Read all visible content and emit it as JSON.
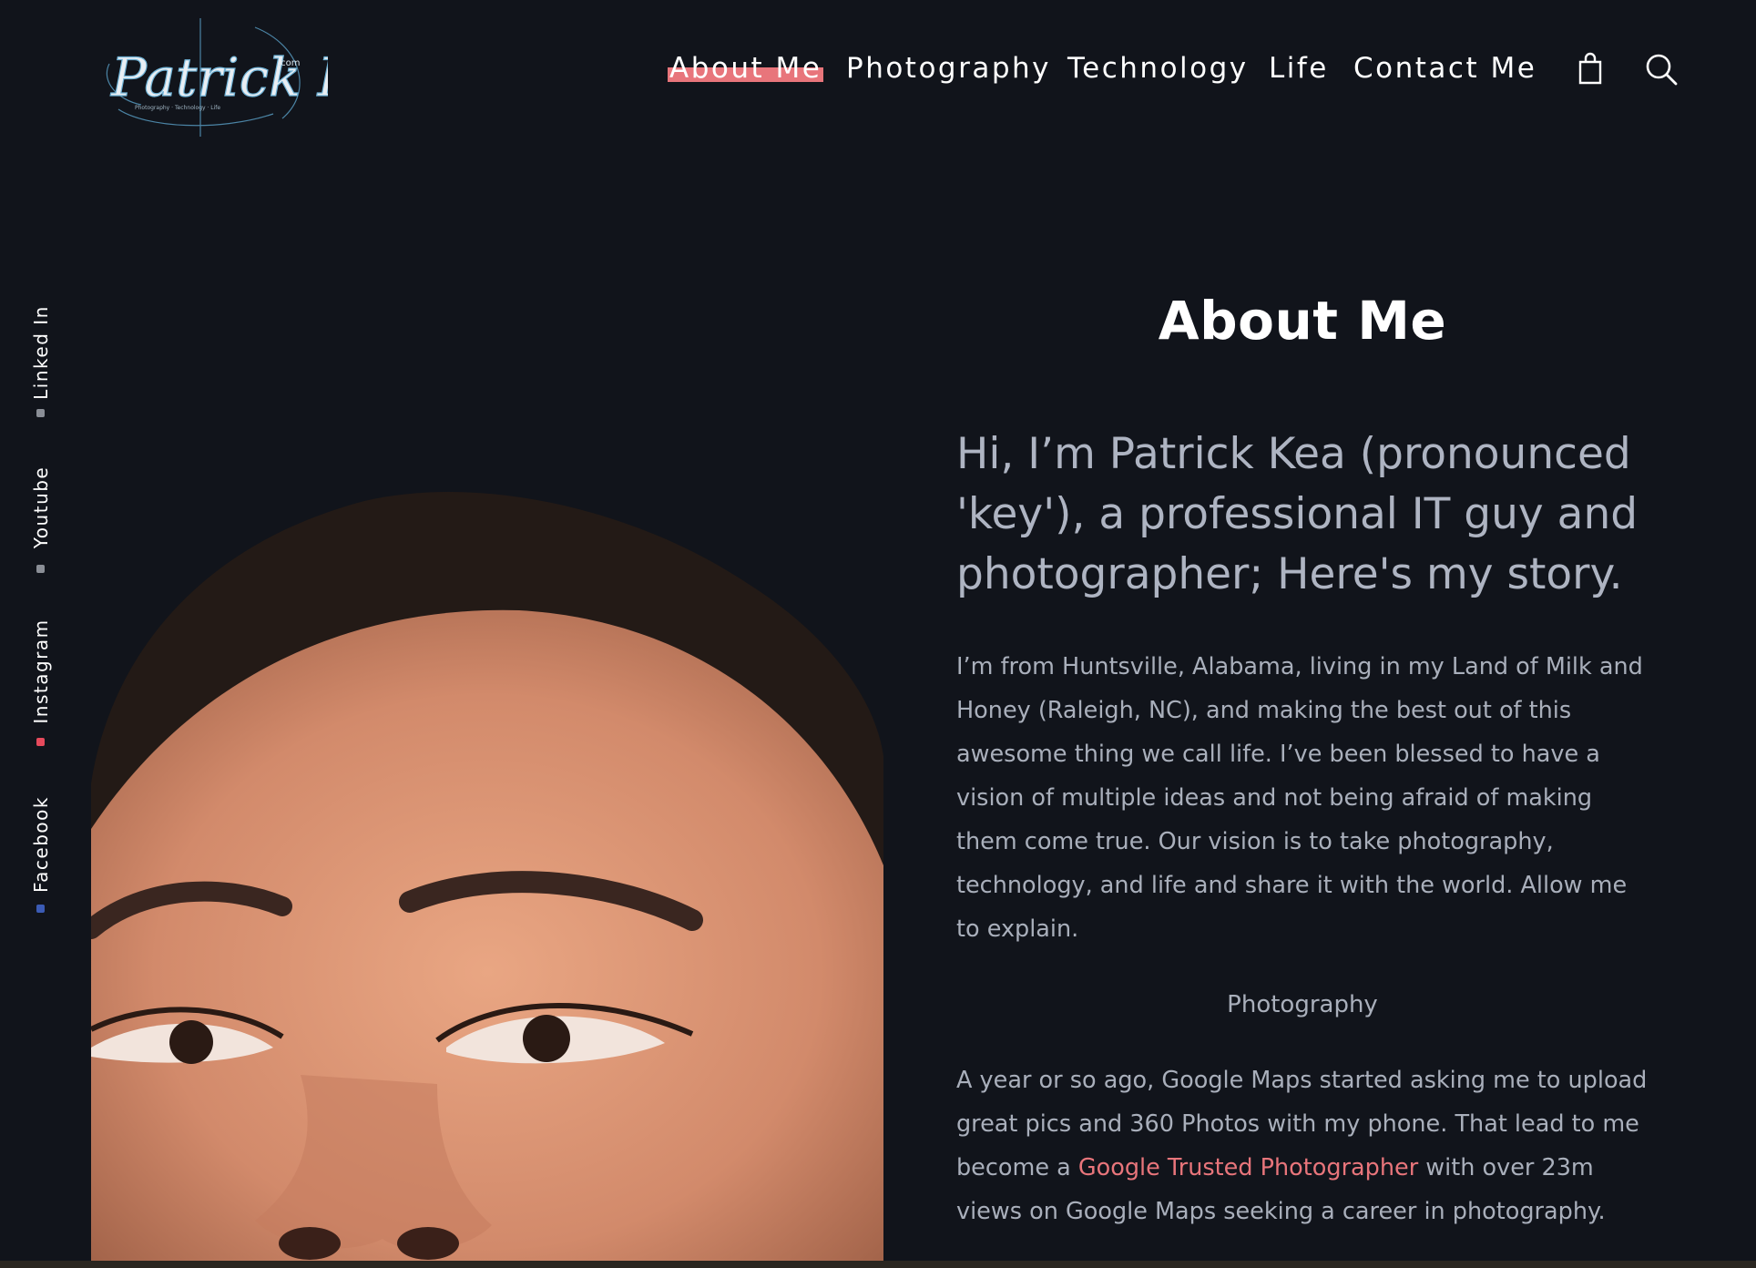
{
  "header": {
    "logo": {
      "text": "Patrick Kea",
      "suffix": ".com",
      "tagline": "Photography · Technology · Life"
    },
    "nav": [
      {
        "label": "About Me",
        "active": true
      },
      {
        "label": "Photography",
        "active": false
      },
      {
        "label": "Technology",
        "active": false
      },
      {
        "label": "Life",
        "active": false
      },
      {
        "label": "Contact Me",
        "active": false
      }
    ],
    "icons": {
      "cart": "shopping-bag-icon",
      "search": "search-icon"
    }
  },
  "social": [
    {
      "label": "Linked In",
      "dot_color": "#8a8e96"
    },
    {
      "label": "Youtube",
      "dot_color": "#8a8e96"
    },
    {
      "label": "Instagram",
      "dot_color": "#e64a5c"
    },
    {
      "label": "Facebook",
      "dot_color": "#3b5bb5"
    }
  ],
  "main": {
    "title": "About Me",
    "intro": "Hi, I’m Patrick Kea (pronounced 'key'), a professional IT guy and photographer; Here's my story.",
    "paragraph1": "I’m from Huntsville, Alabama, living in my Land of Milk and Honey (Raleigh, NC), and making the best out of this awesome thing we call life. I’ve been blessed to have a vision of multiple ideas and not being afraid of making them come true. Our vision is to take photography, technology, and life and share it with the world. Allow me to explain.",
    "section_heading": "Photography",
    "paragraph2_before": "A year or so ago, Google Maps started asking me to upload great pics and 360 Photos with my phone. That lead to me become a ",
    "paragraph2_link": "Google Trusted Photographer",
    "paragraph2_after": " with over 23m views on Google Maps seeking a career in photography."
  },
  "colors": {
    "background": "#11141b",
    "accent": "#e8757b",
    "body_text": "#a9afbb"
  }
}
